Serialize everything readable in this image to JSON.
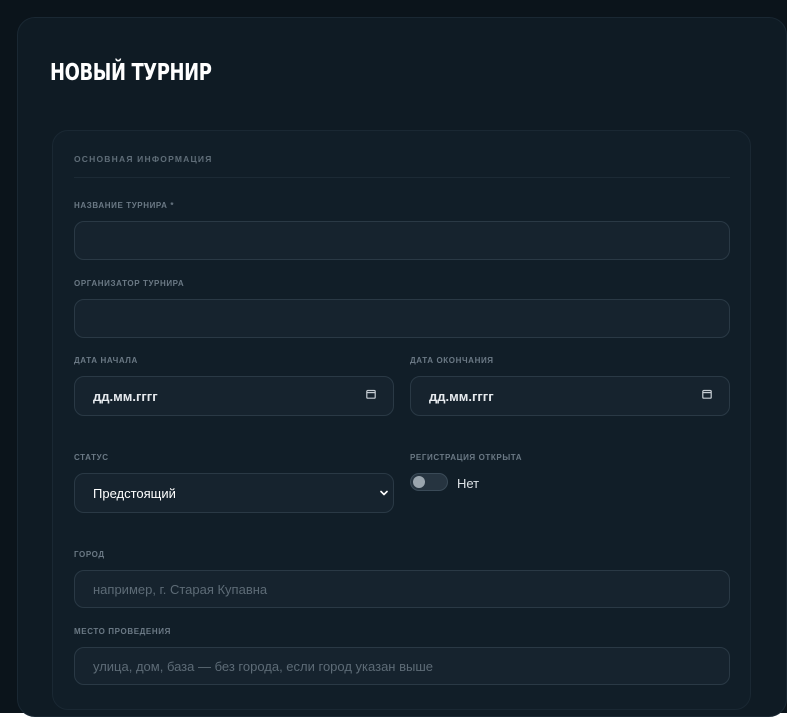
{
  "page": {
    "title": "НОВЫЙ ТУРНИР"
  },
  "section": {
    "title": "ОСНОВНАЯ ИНФОРМАЦИЯ"
  },
  "fields": {
    "name": {
      "label": "НАЗВАНИЕ ТУРНИРА *",
      "value": "",
      "placeholder": ""
    },
    "organizer": {
      "label": "ОРГАНИЗАТОР ТУРНИРА",
      "value": "",
      "placeholder": ""
    },
    "start_date": {
      "label": "ДАТА НАЧАЛА",
      "value": "дд.мм.гггг",
      "icon": "calendar-icon"
    },
    "end_date": {
      "label": "ДАТА ОКОНЧАНИЯ",
      "value": "дд.мм.гггг",
      "icon": "calendar-icon"
    },
    "status": {
      "label": "СТАТУС",
      "selected": "Предстоящий",
      "icon": "chevron-down-icon"
    },
    "registration": {
      "label": "РЕГИСТРАЦИЯ ОТКРЫТА",
      "enabled": false,
      "value_text": "Нет"
    },
    "city": {
      "label": "ГОРОД",
      "value": "",
      "placeholder": "например, г. Старая Купавна"
    },
    "venue": {
      "label": "МЕСТО ПРОВЕДЕНИЯ",
      "value": "",
      "placeholder": "улица, дом, база — без города, если город указан выше"
    }
  },
  "colors": {
    "background": "#0b141b",
    "card": "#0f1b24",
    "input_bg": "#16232e",
    "input_border": "#2a3945",
    "label": "#6b7985",
    "text": "#ffffff"
  }
}
